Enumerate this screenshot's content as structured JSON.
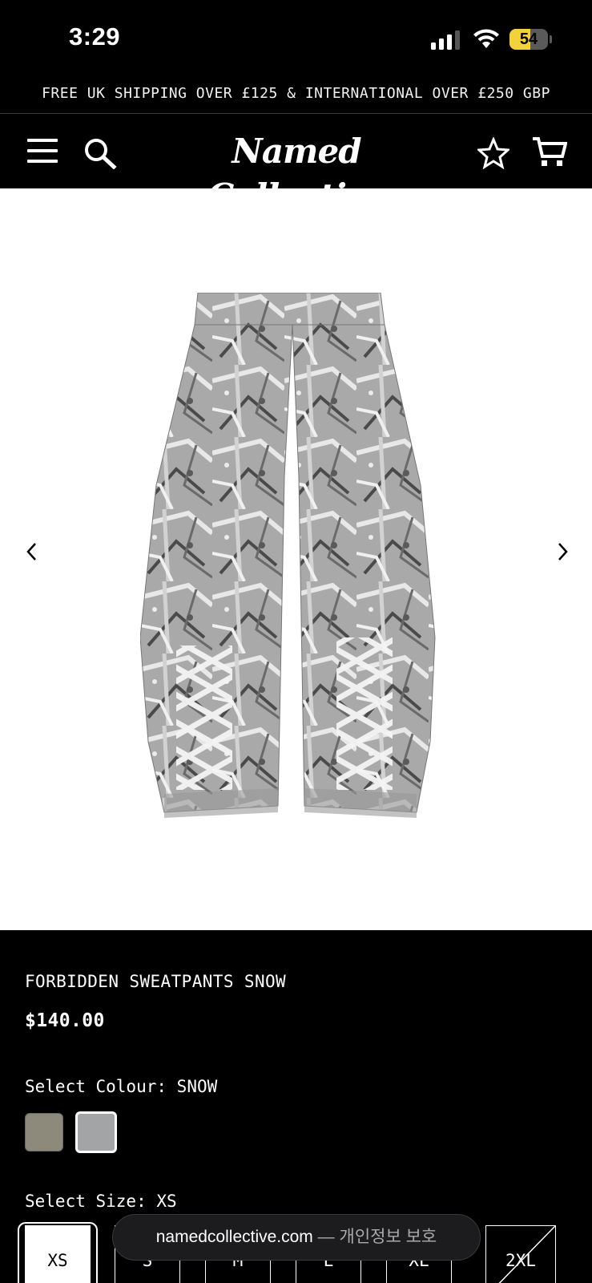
{
  "status_bar": {
    "time": "3:29",
    "battery_percent": "54",
    "battery_level": 0.54,
    "battery_color": "#f3d13a"
  },
  "announcement": {
    "text": "FREE UK SHIPPING OVER £125 & INTERNATIONAL OVER £250 GBP"
  },
  "header": {
    "brand": "Named Collective",
    "icons": [
      "menu-icon",
      "search-icon",
      "star-icon",
      "cart-icon"
    ]
  },
  "gallery": {
    "image_alt": "camo sweatpants with lace-up detail",
    "prev_icon": "chevron-left-icon",
    "next_icon": "chevron-right-icon"
  },
  "product": {
    "title": "FORBIDDEN SWEATPANTS SNOW",
    "price": "$140.00",
    "colour_label": "Select Colour:",
    "colour_value": "SNOW",
    "swatches": [
      {
        "name": "grey-olive",
        "color": "#8d8a7c"
      },
      {
        "name": "snow",
        "color": "#a3a4a6",
        "selected": true
      }
    ],
    "size_label": "Select Size:",
    "size_value": "XS",
    "sizes": [
      {
        "label": "XS",
        "selected": true
      },
      {
        "label": "S"
      },
      {
        "label": "M"
      },
      {
        "label": "L"
      },
      {
        "label": "XL"
      },
      {
        "label": "2XL",
        "sold_out": true
      }
    ]
  },
  "browser": {
    "domain": "namedcollective.com",
    "separator": "—",
    "privacy_text": "개인정보 보호"
  }
}
